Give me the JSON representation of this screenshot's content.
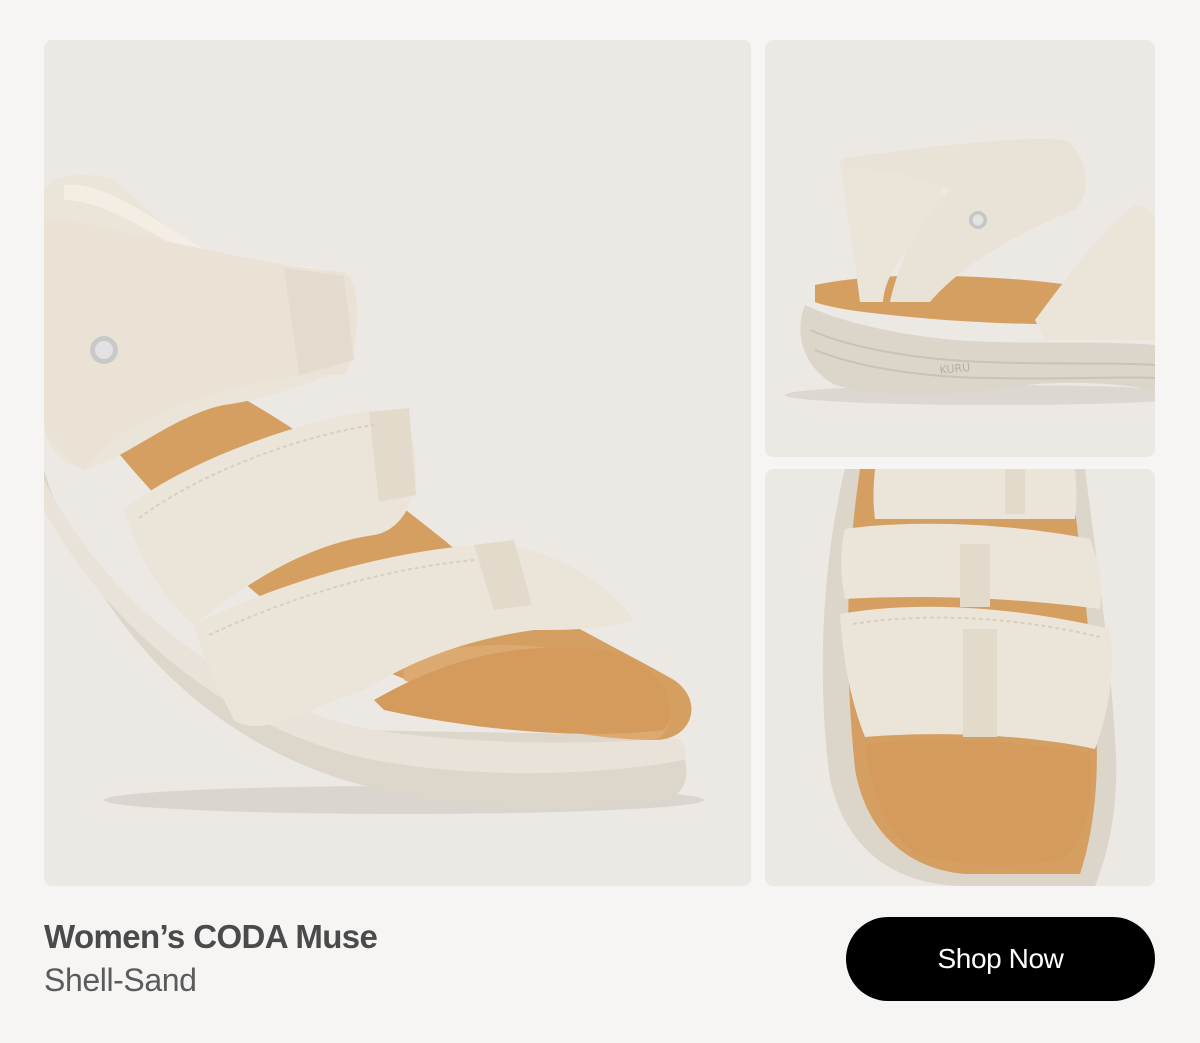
{
  "product": {
    "name": "Women’s CODA Muse",
    "color": "Shell-Sand",
    "cta_label": "Shop Now",
    "sole_brand": "KURU"
  },
  "images": [
    {
      "view": "angled-front",
      "icon": "sandal-image"
    },
    {
      "view": "side-profile",
      "icon": "sandal-image"
    },
    {
      "view": "top-down",
      "icon": "sandal-image"
    }
  ],
  "colors": {
    "page_background": "#f6f5f4",
    "panel_background": "#ece8e3",
    "strap": "#ebe4d8",
    "footbed": "#d69f62",
    "sole": "#dcd5ca",
    "button": "#000000",
    "button_text": "#ffffff"
  }
}
